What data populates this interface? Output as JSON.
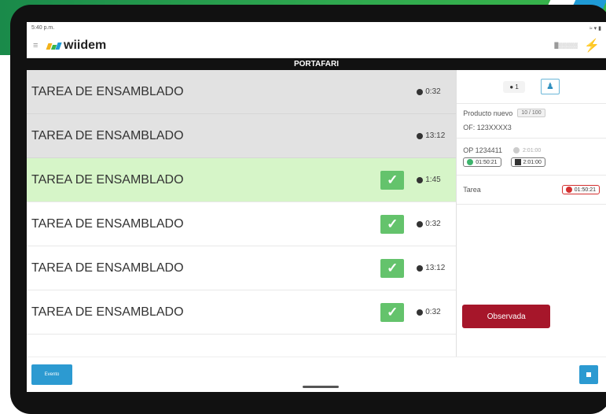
{
  "status_bar": {
    "left": "5:40 p.m.",
    "right": "≈ ▾ ▮"
  },
  "app": {
    "logo": "wiidem",
    "signal": "█▒▒▒▒▒"
  },
  "title": "PORTAFARI",
  "tasks": [
    {
      "name": "TAREA DE ENSAMBLADO",
      "time": "0:32",
      "state": "gray",
      "checked": false
    },
    {
      "name": "TAREA DE ENSAMBLADO",
      "time": "13:12",
      "state": "gray",
      "checked": false
    },
    {
      "name": "TAREA DE ENSAMBLADO",
      "time": "1:45",
      "state": "green",
      "checked": true
    },
    {
      "name": "TAREA DE ENSAMBLADO",
      "time": "0:32",
      "state": "white",
      "checked": true
    },
    {
      "name": "TAREA DE ENSAMBLADO",
      "time": "13:12",
      "state": "white",
      "checked": true
    },
    {
      "name": "TAREA DE ENSAMBLADO",
      "time": "0:32",
      "state": "white",
      "checked": true
    }
  ],
  "panel": {
    "count": "1",
    "product_label": "Producto nuevo",
    "product_tag": "10 / 100",
    "of_label": "OF: 123XXXX3",
    "op_label": "OP 1234411",
    "op_muted_time": "2:01:00",
    "elapsed": "01:50:21",
    "planned": "2:01:00",
    "tarea_label": "Tarea",
    "tarea_time": "01:50:21",
    "observed_label": "Observada"
  },
  "bottom": {
    "event_label": "Evento"
  },
  "colors": {
    "accent_blue": "#2c9ad1",
    "green_row": "#d6f5c8",
    "observed_red": "#a6162a",
    "check_green": "#64c36c"
  }
}
